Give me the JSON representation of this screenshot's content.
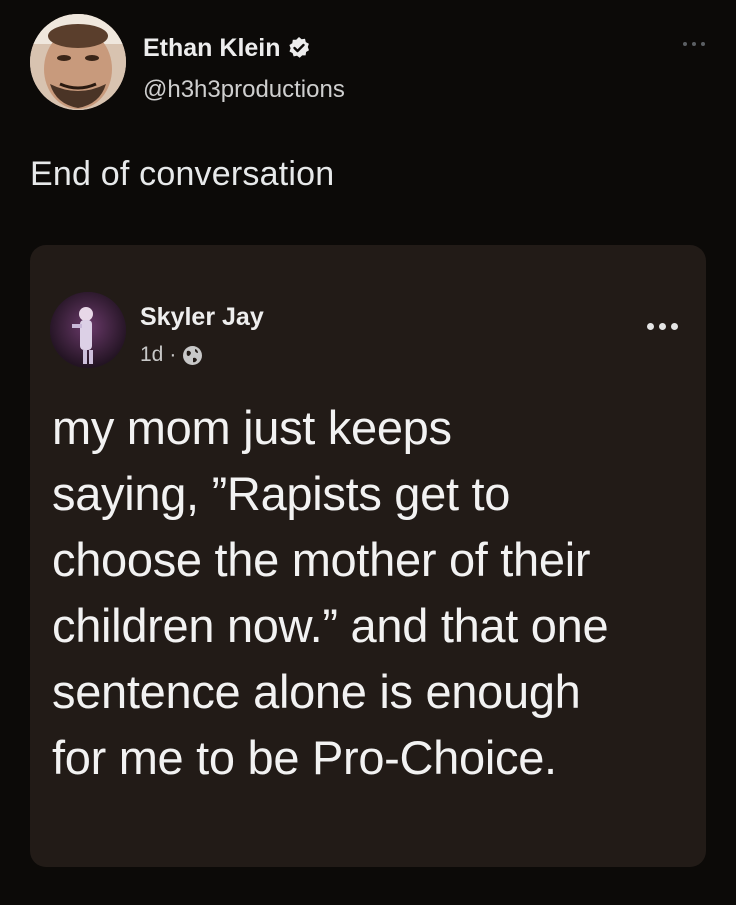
{
  "tweet": {
    "author_name": "Ethan Klein",
    "author_handle": "@h3h3productions",
    "text": "End of conversation",
    "verified_icon": "verified-badge-icon",
    "more_icon": "more-options-icon"
  },
  "embedded_post": {
    "author_name": "Skyler Jay",
    "timestamp": "1d",
    "separator": "·",
    "visibility_icon": "globe-icon",
    "more_icon": "more-options-icon",
    "text": "my mom just keeps\nsaying, ”Rapists get to\nchoose the mother of their\nchildren now.” and that one\nsentence alone is enough\nfor me to be Pro-Choice."
  },
  "colors": {
    "background": "#0c0a08",
    "card_background": "#221b17",
    "primary_text": "#e7e9ea",
    "secondary_text": "#cfcfcf"
  }
}
